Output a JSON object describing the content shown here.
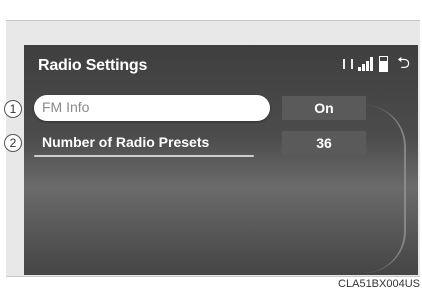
{
  "screen": {
    "title": "Radio Settings",
    "status_icons": [
      "bluetooth-icon",
      "signal-icon",
      "battery-icon",
      "back-icon"
    ]
  },
  "settings": [
    {
      "label": "FM Info",
      "value": "On"
    },
    {
      "label": "Number of Radio Presets",
      "value": "36"
    }
  ],
  "callouts": [
    "1",
    "2"
  ],
  "caption": "CLA51BX004US",
  "colors": {
    "accent": "#ffffff",
    "screen_bg": "#4a4a4a"
  }
}
